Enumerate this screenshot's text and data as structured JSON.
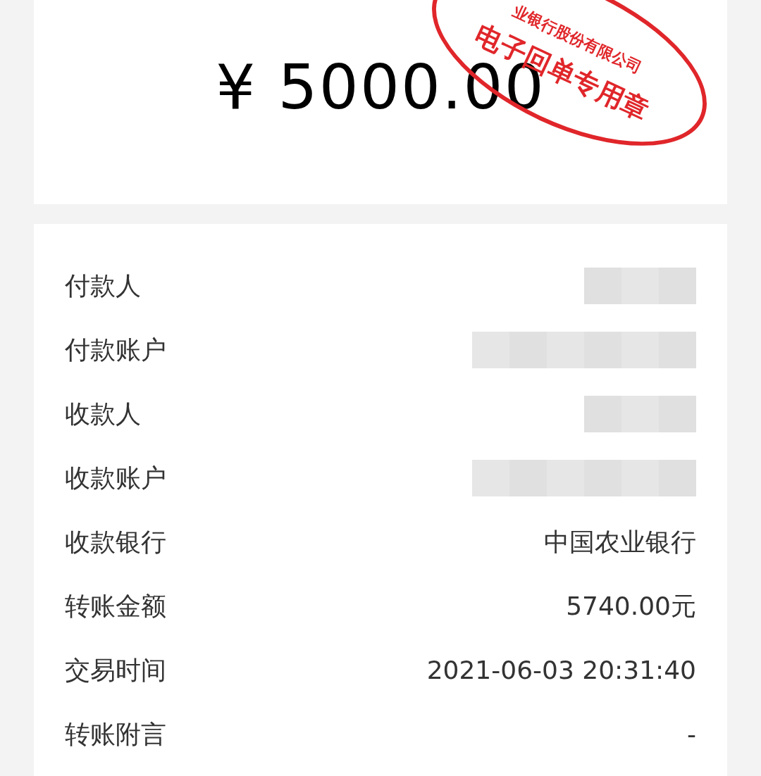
{
  "amount": "¥ 5000.00",
  "stamp": {
    "issuer": "业银行股份有限公司",
    "title": "电子回单专用章"
  },
  "rows": [
    {
      "label": "付款人",
      "kind": "mask"
    },
    {
      "label": "付款账户",
      "kind": "widemask"
    },
    {
      "label": "收款人",
      "kind": "mask"
    },
    {
      "label": "收款账户",
      "kind": "widemask"
    },
    {
      "label": "收款银行",
      "kind": "text",
      "value": "中国农业银行"
    },
    {
      "label": "转账金额",
      "kind": "text",
      "value": "5740.00元"
    },
    {
      "label": "交易时间",
      "kind": "text",
      "value": "2021-06-03 20:31:40"
    },
    {
      "label": "转账附言",
      "kind": "text",
      "value": "-"
    }
  ]
}
